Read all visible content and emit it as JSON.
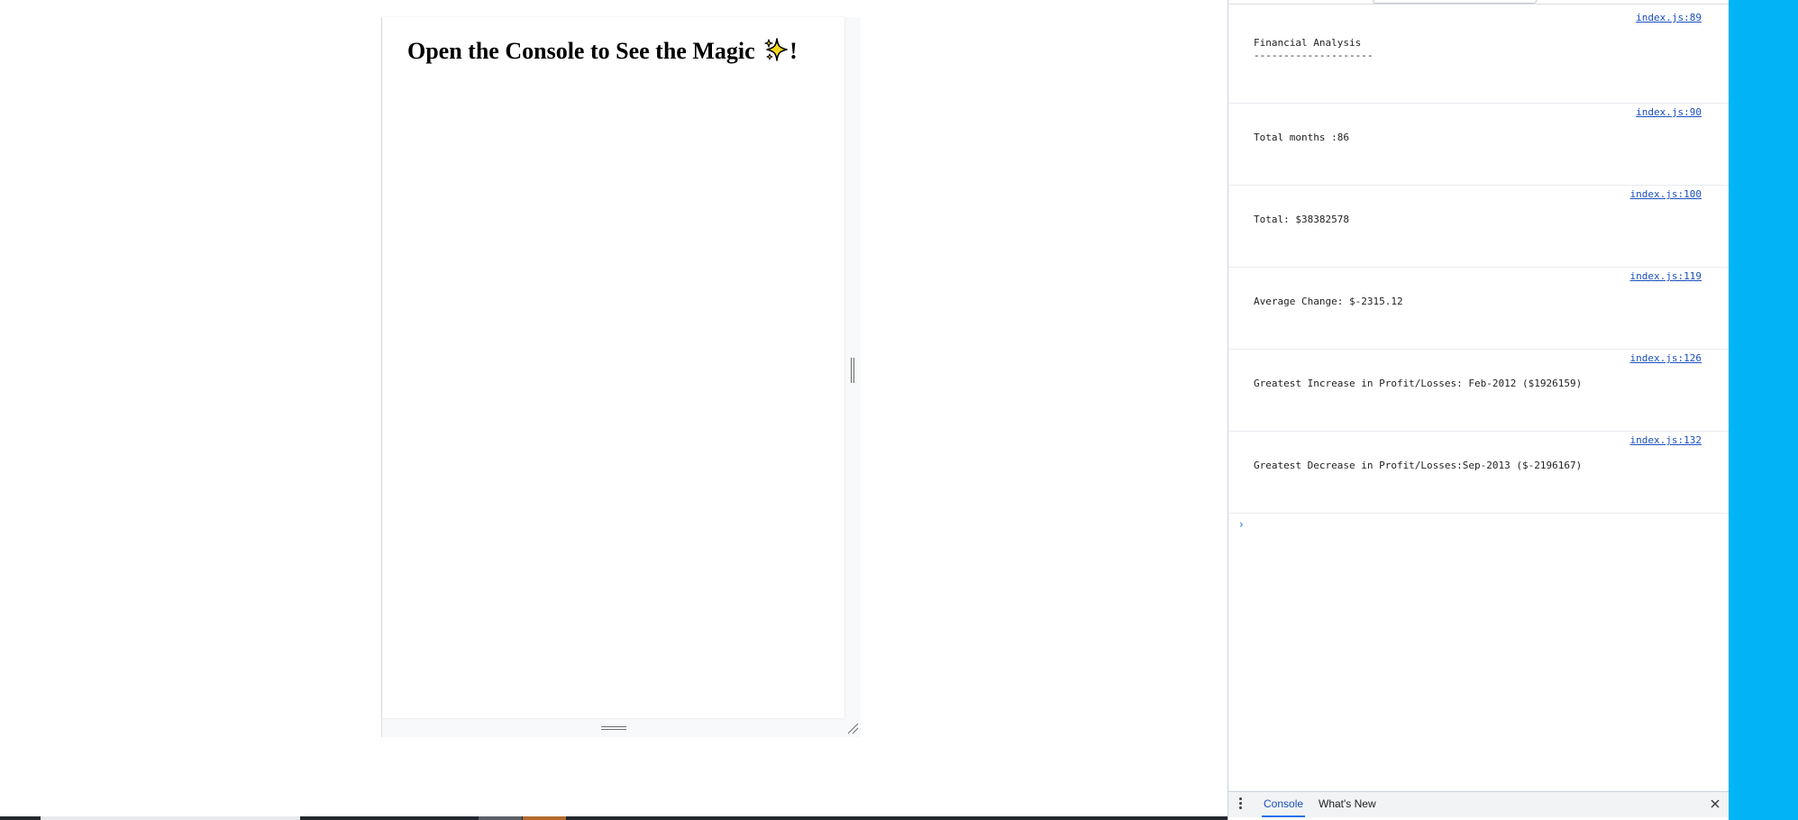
{
  "page": {
    "heading_text": "Open the Console to See the Magic",
    "heading_suffix": "!",
    "heading_icon": "sparkles-icon"
  },
  "console": {
    "logs": [
      {
        "message": "Financial Analysis\n--------------------",
        "source": "index.js:89"
      },
      {
        "message": "Total months :86",
        "source": "index.js:90"
      },
      {
        "message": "Total: $38382578",
        "source": "index.js:100"
      },
      {
        "message": "Average Change: $-2315.12",
        "source": "index.js:119"
      },
      {
        "message": "Greatest Increase in Profit/Losses: Feb-2012 ($1926159)",
        "source": "index.js:126"
      },
      {
        "message": "Greatest Decrease in Profit/Losses:Sep-2013 ($-2196167)",
        "source": "index.js:132"
      }
    ],
    "prompt_symbol": "›"
  },
  "drawer": {
    "tabs": [
      {
        "label": "Console",
        "active": true
      },
      {
        "label": "What's New",
        "active": false
      }
    ]
  },
  "colors": {
    "accent_blue": "#1a73e8",
    "link_blue": "#1a4fbf",
    "right_strip": "#00b4f5"
  }
}
